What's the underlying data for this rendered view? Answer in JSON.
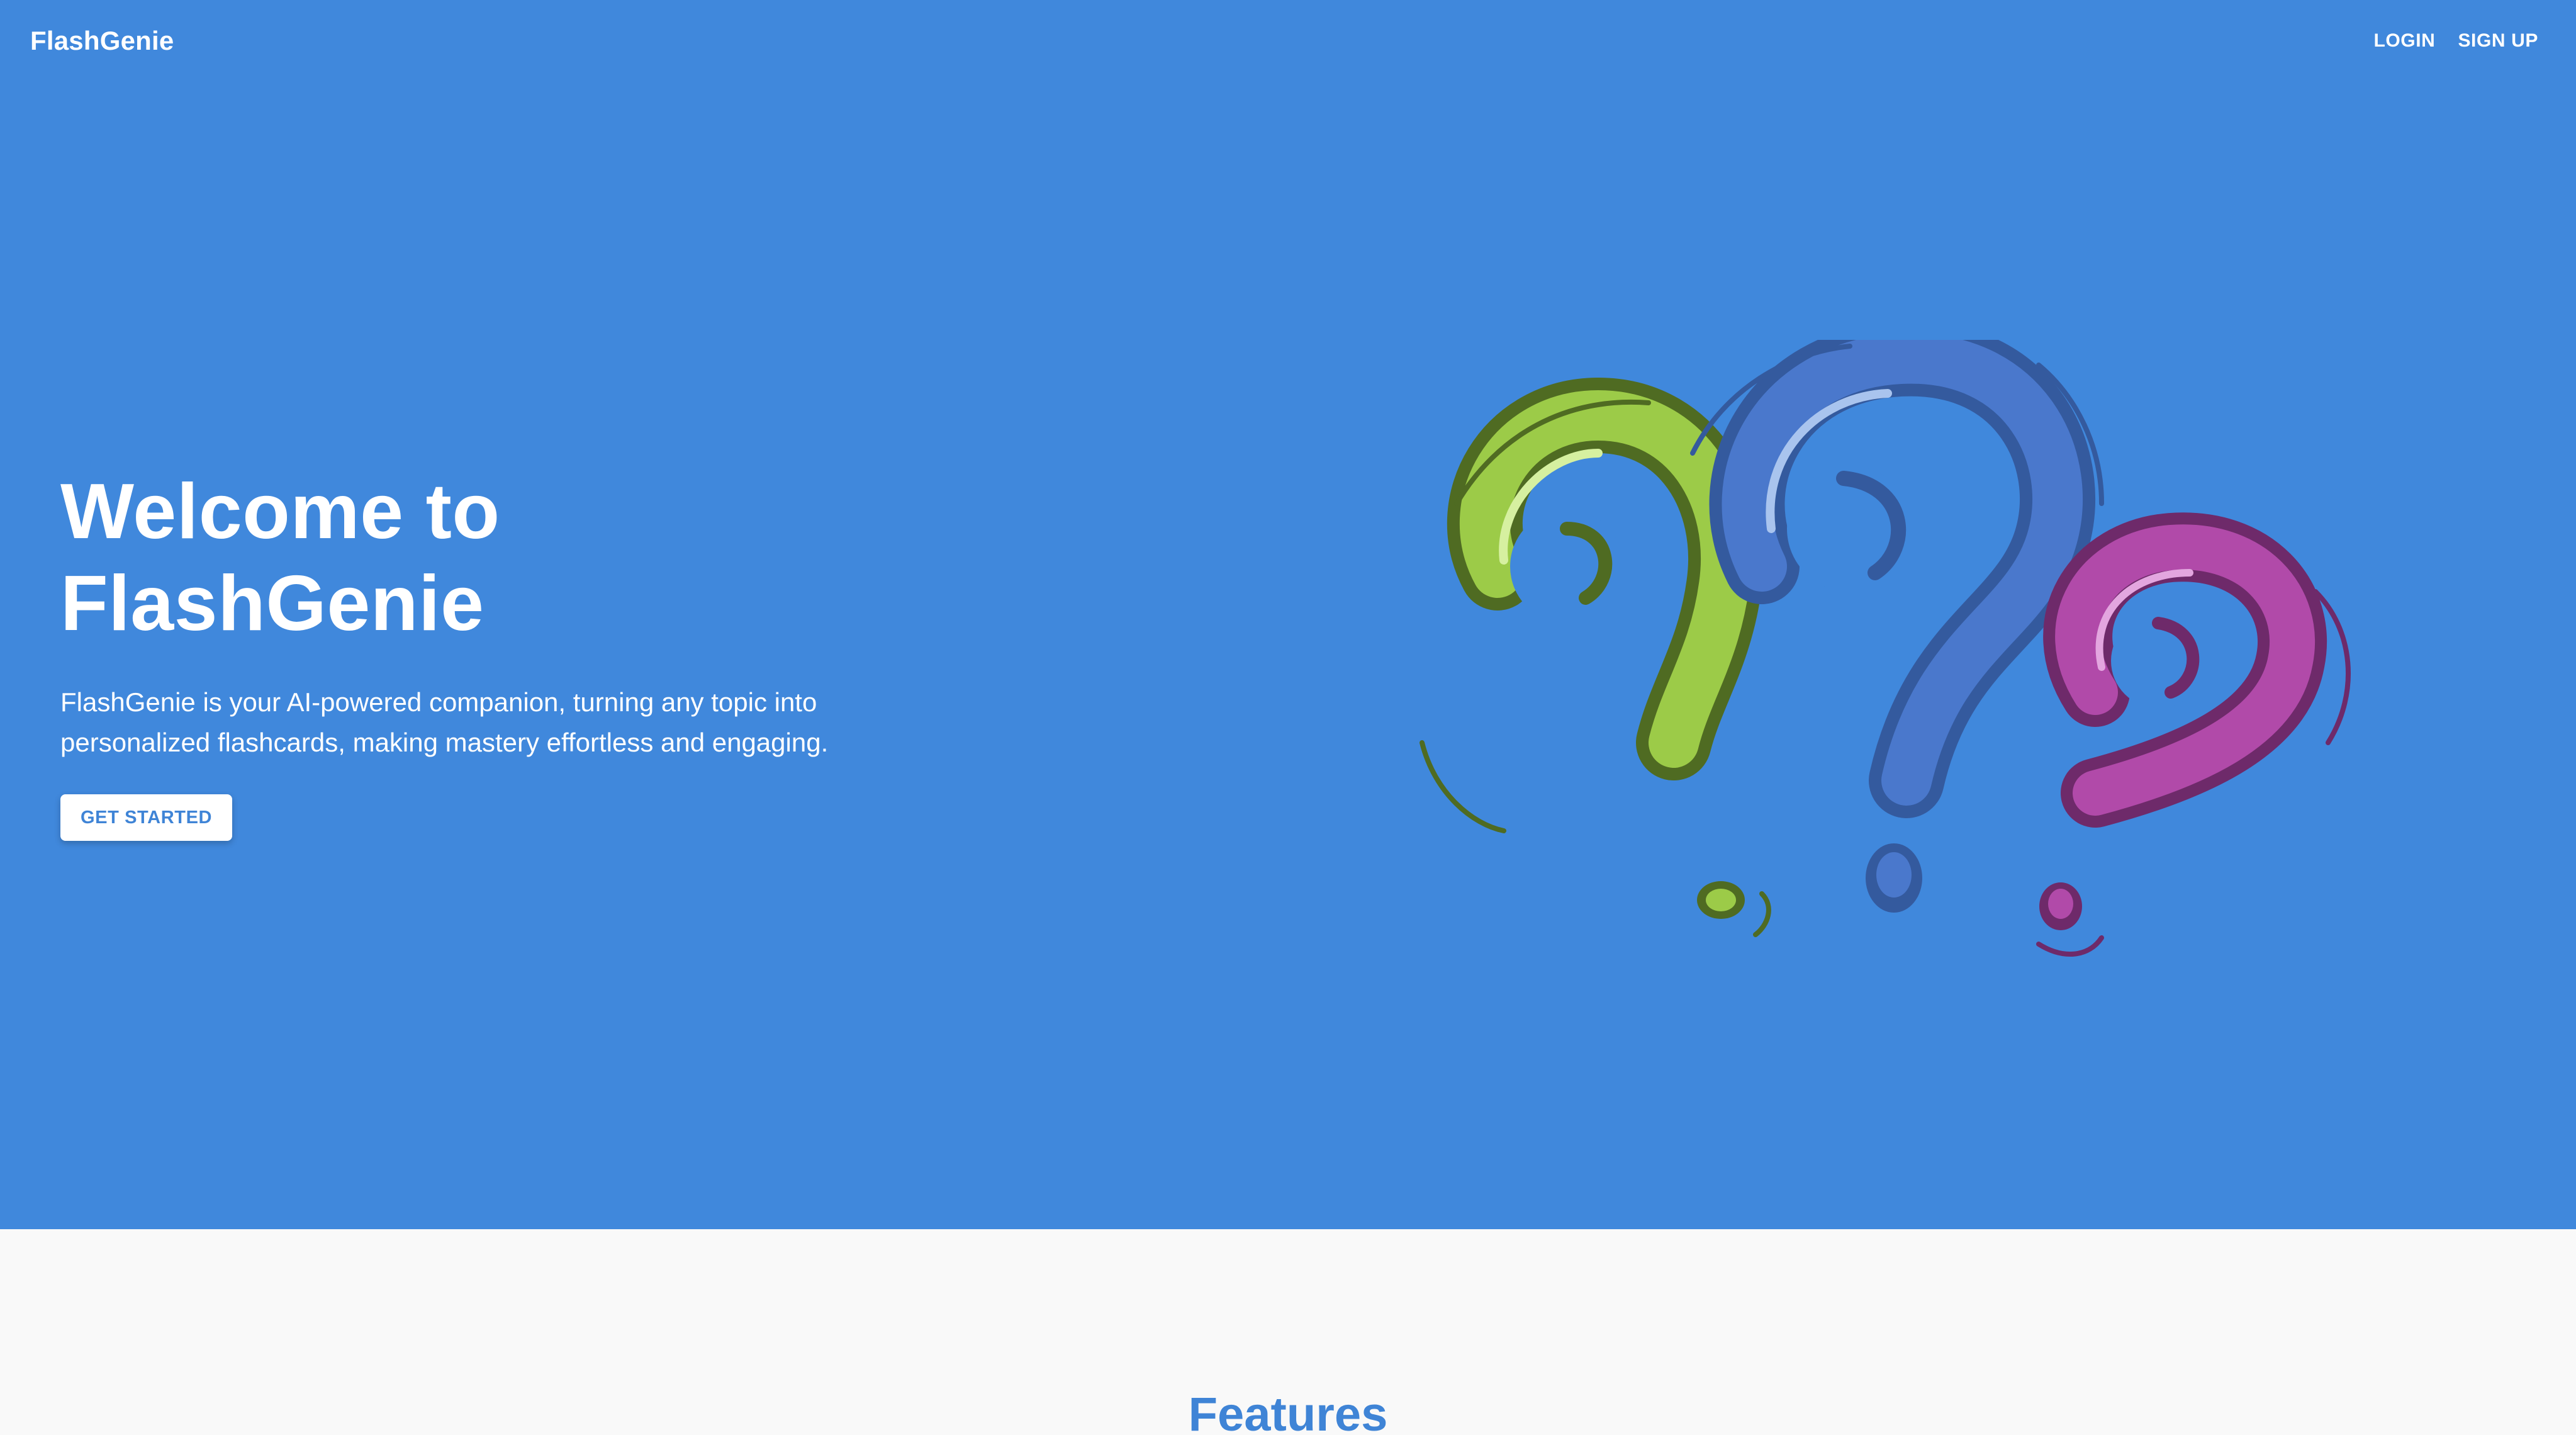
{
  "brand": {
    "name": "FlashGenie"
  },
  "nav": {
    "login_label": "LOGIN",
    "signup_label": "SIGN UP"
  },
  "hero": {
    "title_line1": "Welcome to",
    "title_line2": "FlashGenie",
    "description_line1": "FlashGenie is your AI-powered companion, turning any topic into",
    "description_line2": "personalized flashcards, making mastery effortless and engaging.",
    "cta_label": "GET STARTED",
    "illustration": "question-marks-illustration"
  },
  "features": {
    "heading": "Features"
  },
  "colors": {
    "hero_background": "#4088dc",
    "page_background": "#f9f9f9",
    "accent": "#3f84d6",
    "green_mark": "#9ccb48",
    "blue_mark": "#4a78cc",
    "magenta_mark": "#b14aa9"
  }
}
